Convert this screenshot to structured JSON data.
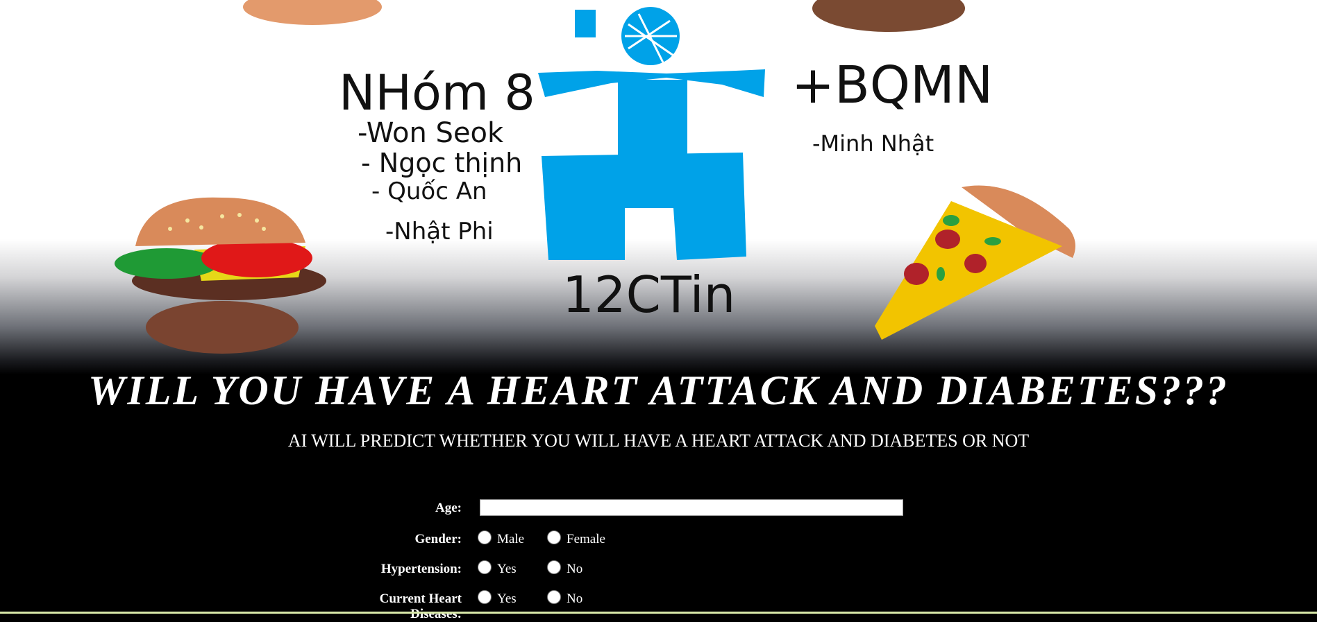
{
  "header": {
    "drawing": {
      "group_title": "NHóm 8",
      "members": [
        "-Won Seok",
        "- Ngọc thịnh",
        "- Quốc An",
        "-Nhật Phi"
      ],
      "plus_title": "+BQMN",
      "plus_members": [
        "-Minh Nhật"
      ],
      "class_name": "12CTin"
    }
  },
  "main": {
    "title": "WILL YOU HAVE A HEART ATTACK AND DIABETES???",
    "subtitle": "AI WILL PREDICT WHETHER YOU WILL HAVE A HEART ATTACK AND DIABETES OR NOT"
  },
  "form": {
    "age": {
      "label": "Age:",
      "value": ""
    },
    "gender": {
      "label": "Gender:",
      "options": [
        "Male",
        "Female"
      ]
    },
    "hypertension": {
      "label": "Hypertension:",
      "options": [
        "Yes",
        "No"
      ]
    },
    "heart_disease": {
      "label": "Current Heart Diseases:",
      "options": [
        "Yes",
        "No"
      ]
    }
  },
  "colors": {
    "background": "#000000",
    "text": "#ffffff",
    "logo_blue": "#00a2e8"
  }
}
